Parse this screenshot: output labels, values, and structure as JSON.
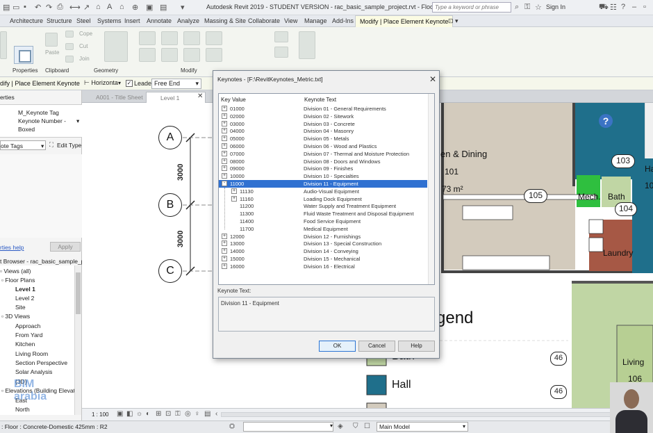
{
  "window": {
    "title": "Autodesk Revit 2019 - STUDENT VERSION - rac_basic_sample_project.rvt - Floor Plan: Level 1",
    "search_placeholder": "Type a keyword or phrase",
    "sign_in": "Sign In"
  },
  "ribbon_tabs": [
    "Architecture",
    "Structure",
    "Steel",
    "Systems",
    "Insert",
    "Annotate",
    "Analyze",
    "Massing & Site",
    "Collaborate",
    "View",
    "Manage",
    "Add-Ins",
    "Modify | Place Element Keynote"
  ],
  "ribbon": {
    "groups": [
      "Properties",
      "Clipboard",
      "Geometry",
      "Modify"
    ],
    "ghost_labels": [
      "Cope",
      "Cut",
      "Join",
      "Paste"
    ]
  },
  "options_bar": {
    "context": "dify | Place Element Keynote",
    "orientation": "Horizonta",
    "leader_label": "Leader",
    "leader_checked": true,
    "leader_end": "Free End"
  },
  "properties": {
    "header": "erties",
    "family": "M_Keynote Tag",
    "type_line1": "Keynote Number -",
    "type_line2": "Boxed",
    "category": "ote Tags",
    "edit_type": "Edit Type",
    "help_link": "rties help",
    "apply": "Apply"
  },
  "project_browser": {
    "title": "t Browser - rac_basic_sample_pr...",
    "items": [
      {
        "label": "Views (all)",
        "indent": 0,
        "bold": false
      },
      {
        "label": "Floor Plans",
        "indent": 1,
        "bold": false
      },
      {
        "label": "Level 1",
        "indent": 2,
        "bold": true
      },
      {
        "label": "Level 2",
        "indent": 2,
        "bold": false
      },
      {
        "label": "Site",
        "indent": 2,
        "bold": false
      },
      {
        "label": "3D Views",
        "indent": 1,
        "bold": false
      },
      {
        "label": "Approach",
        "indent": 2,
        "bold": false
      },
      {
        "label": "From Yard",
        "indent": 2,
        "bold": false
      },
      {
        "label": "Kitchen",
        "indent": 2,
        "bold": false
      },
      {
        "label": "Living Room",
        "indent": 2,
        "bold": false
      },
      {
        "label": "Section Perspective",
        "indent": 2,
        "bold": false
      },
      {
        "label": "Solar Analysis",
        "indent": 2,
        "bold": false
      },
      {
        "label": "{3D}",
        "indent": 2,
        "bold": false
      },
      {
        "label": "Elevations (Building Elevatio",
        "indent": 1,
        "bold": false
      },
      {
        "label": "East",
        "indent": 2,
        "bold": false
      },
      {
        "label": "North",
        "indent": 2,
        "bold": false
      }
    ]
  },
  "view_tabs": [
    {
      "label": "A001 - Title Sheet",
      "active": false
    },
    {
      "label": "Level 1",
      "active": true
    }
  ],
  "canvas": {
    "grid_bubbles": [
      "A",
      "B",
      "C"
    ],
    "dimensions": [
      "3000",
      "3000"
    ],
    "rooms": {
      "kitchen": "en & Dining",
      "kitchen_num": "101",
      "area": "73 m²",
      "mech": "Mech.",
      "bath": "Bath",
      "laundry": "Laundry",
      "hall_partial": "Ha",
      "partial_num": "10",
      "living": "Living",
      "living_num": "106"
    },
    "tags": [
      "103",
      "105",
      "104",
      "46",
      "46"
    ],
    "legend_title": "gend",
    "legend_items": [
      "Bath",
      "Hall"
    ],
    "help": "?"
  },
  "view_bar": {
    "scale": "1 : 100"
  },
  "status_bar": {
    "text": ": Floor : Concrete-Domestic 425mm : R2",
    "workset_value": "",
    "model": "Main Model"
  },
  "dialog": {
    "title": "Keynotes - [F:\\RevitKeynotes_Metric.txt]",
    "col_key": "Key Value",
    "col_text": "Keynote Text",
    "rows": [
      {
        "key": "01000",
        "text": "Division 01 - General Requirements",
        "level": 0,
        "exp": "+",
        "sel": false
      },
      {
        "key": "02000",
        "text": "Division 02 - Sitework",
        "level": 0,
        "exp": "+",
        "sel": false
      },
      {
        "key": "03000",
        "text": "Division 03 - Concrete",
        "level": 0,
        "exp": "+",
        "sel": false
      },
      {
        "key": "04000",
        "text": "Division 04 - Masonry",
        "level": 0,
        "exp": "+",
        "sel": false
      },
      {
        "key": "05000",
        "text": "Division 05 - Metals",
        "level": 0,
        "exp": "+",
        "sel": false
      },
      {
        "key": "06000",
        "text": "Division 06 - Wood and Plastics",
        "level": 0,
        "exp": "+",
        "sel": false
      },
      {
        "key": "07000",
        "text": "Division 07 - Thermal and Moisture Protection",
        "level": 0,
        "exp": "+",
        "sel": false
      },
      {
        "key": "08000",
        "text": "Division 08 - Doors and Windows",
        "level": 0,
        "exp": "+",
        "sel": false
      },
      {
        "key": "09000",
        "text": "Division 09 - Finishes",
        "level": 0,
        "exp": "+",
        "sel": false
      },
      {
        "key": "10000",
        "text": "Division 10 - Specialties",
        "level": 0,
        "exp": "+",
        "sel": false
      },
      {
        "key": "11000",
        "text": "Division 11 - Equipment",
        "level": 0,
        "exp": "-",
        "sel": true
      },
      {
        "key": "11130",
        "text": "Audio-Visual Equipment",
        "level": 1,
        "exp": "+",
        "sel": false
      },
      {
        "key": "11160",
        "text": "Loading Dock Equipment",
        "level": 1,
        "exp": "+",
        "sel": false
      },
      {
        "key": "11200",
        "text": "Water Supply and Treatment Equipment",
        "level": 1,
        "exp": "",
        "sel": false
      },
      {
        "key": "11300",
        "text": "Fluid Waste Treatment and Disposal Equipment",
        "level": 1,
        "exp": "",
        "sel": false
      },
      {
        "key": "11400",
        "text": "Food Service Equipment",
        "level": 1,
        "exp": "",
        "sel": false
      },
      {
        "key": "11700",
        "text": "Medical Equipment",
        "level": 1,
        "exp": "",
        "sel": false
      },
      {
        "key": "12000",
        "text": "Division 12 - Furnishings",
        "level": 0,
        "exp": "+",
        "sel": false
      },
      {
        "key": "13000",
        "text": "Division 13 - Special Construction",
        "level": 0,
        "exp": "+",
        "sel": false
      },
      {
        "key": "14000",
        "text": "Division 14 - Conveying",
        "level": 0,
        "exp": "+",
        "sel": false
      },
      {
        "key": "15000",
        "text": "Division 15 - Mechanical",
        "level": 0,
        "exp": "+",
        "sel": false
      },
      {
        "key": "16000",
        "text": "Division 16 - Electrical",
        "level": 0,
        "exp": "+",
        "sel": false
      }
    ],
    "keynote_text_label": "Keynote Text:",
    "keynote_text_value": "Division 11 - Equipment",
    "ok": "OK",
    "cancel": "Cancel",
    "help": "Help"
  },
  "watermark": "BIM arabia",
  "colors": {
    "selection": "#3071d1",
    "floor_tan": "#d3cbbd",
    "teal": "#1f6f8b",
    "green": "#2fbf3f",
    "brown": "#a65845",
    "lawn": "#c0d6a4",
    "contextual_tab": "#fbfbe3"
  }
}
